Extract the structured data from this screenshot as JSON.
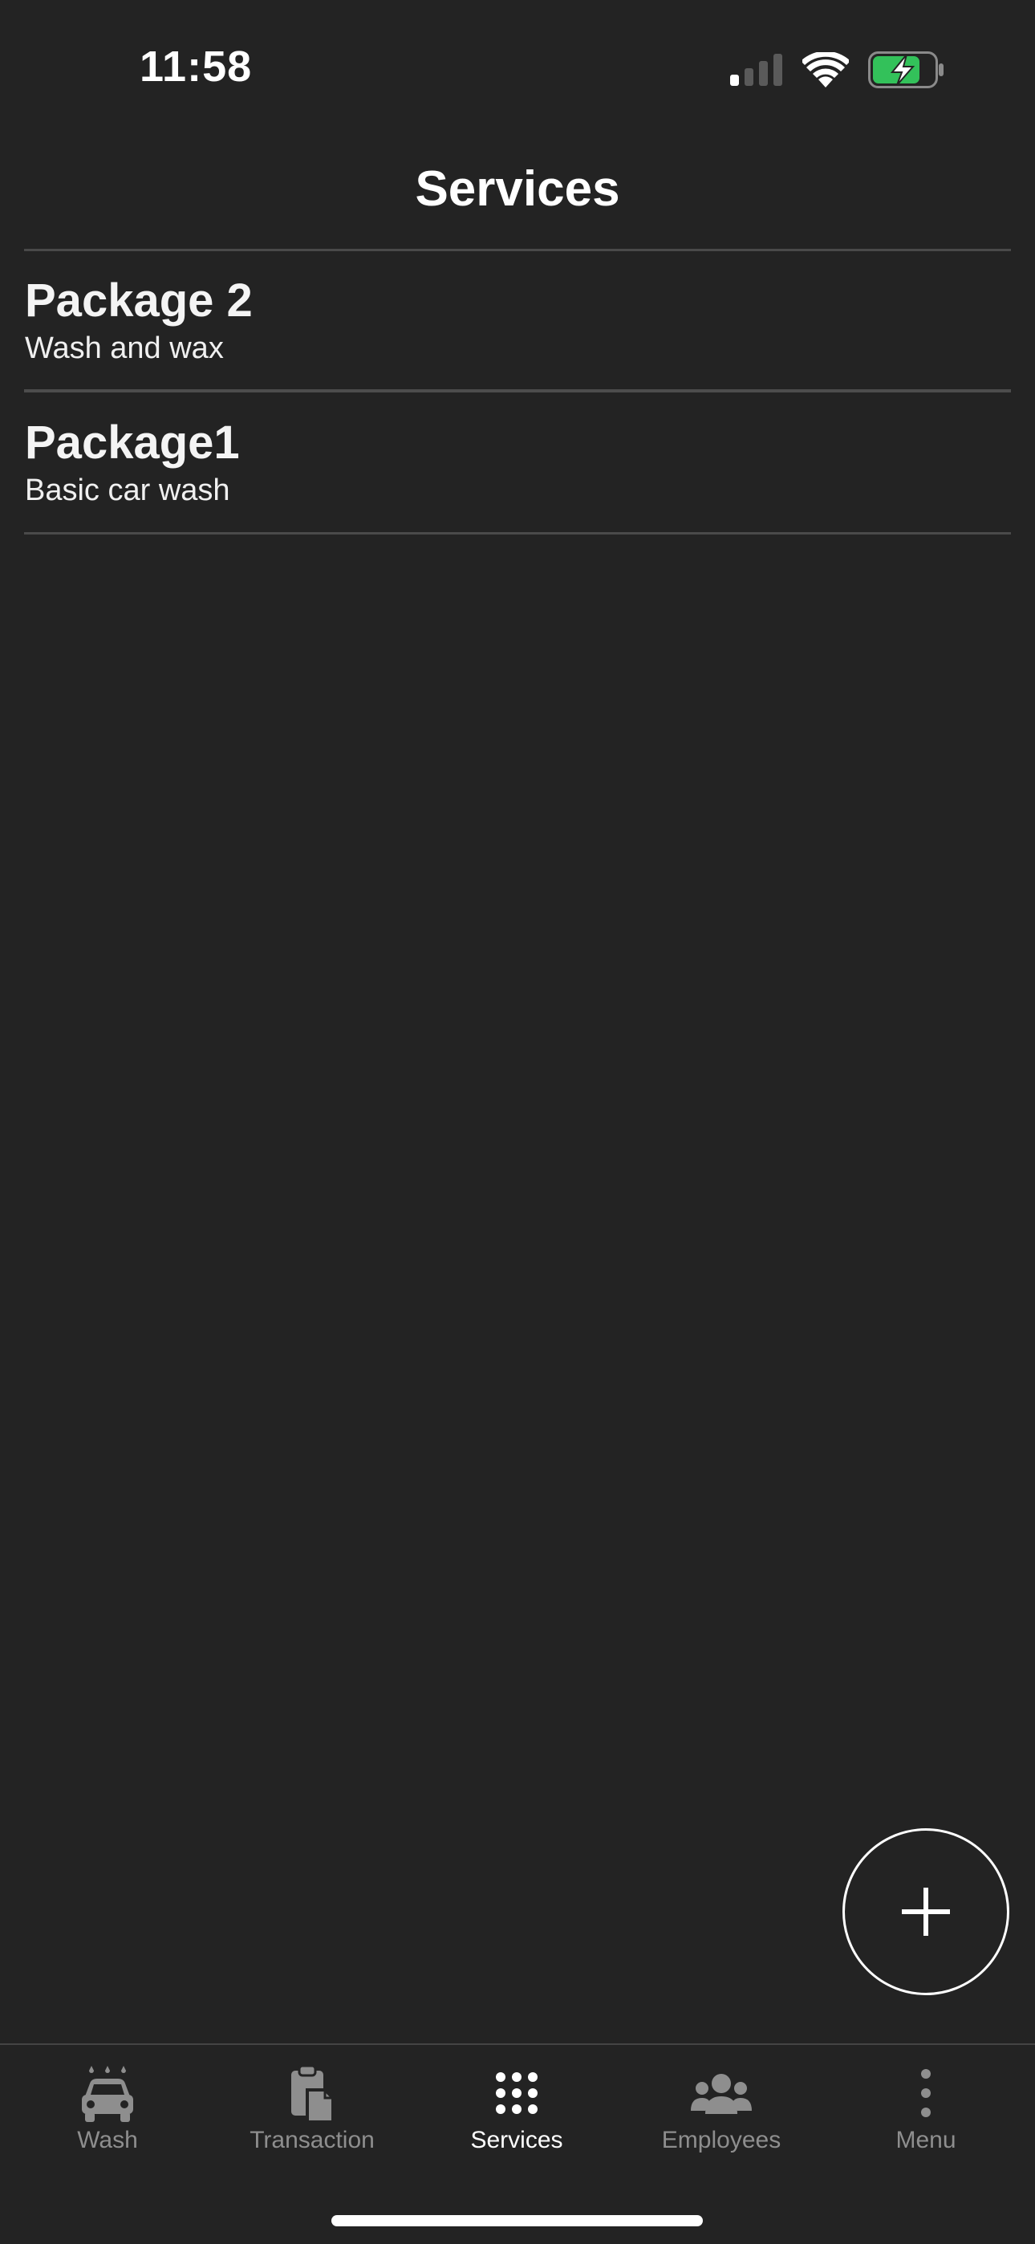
{
  "status_bar": {
    "time": "11:58"
  },
  "nav": {
    "title": "Services"
  },
  "services": [
    {
      "name": "Package 2",
      "description": "Wash and wax"
    },
    {
      "name": "Package1",
      "description": "Basic car wash"
    }
  ],
  "fab": {
    "icon": "plus-icon"
  },
  "tab_bar": {
    "tabs": [
      {
        "label": "Wash",
        "icon": "car-wash-icon",
        "active": false
      },
      {
        "label": "Transaction",
        "icon": "clipboard-icon",
        "active": false
      },
      {
        "label": "Services",
        "icon": "grid-dots-icon",
        "active": true
      },
      {
        "label": "Employees",
        "icon": "people-icon",
        "active": false
      },
      {
        "label": "Menu",
        "icon": "more-vertical-icon",
        "active": false
      }
    ]
  },
  "colors": {
    "background": "#232323",
    "divider": "#4a4a4a",
    "inactive_tab": "#8e8e8e",
    "active_tab": "#ffffff",
    "battery_fill": "#33c15a"
  }
}
